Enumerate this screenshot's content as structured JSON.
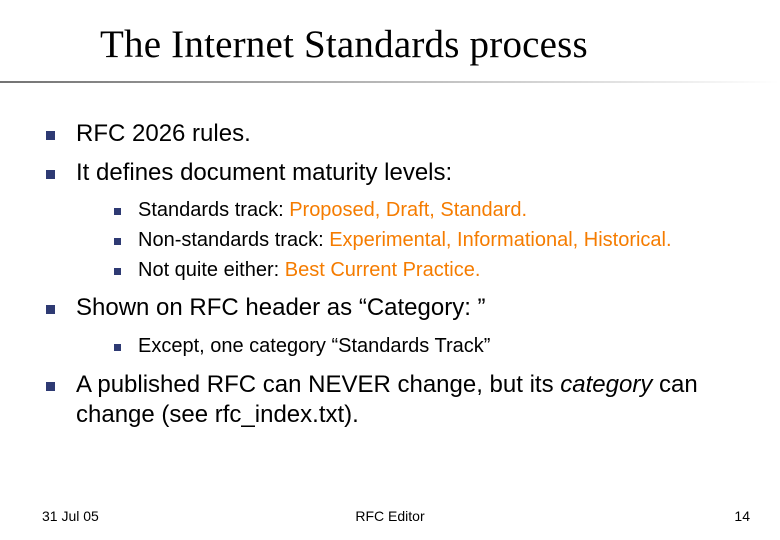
{
  "title": "The Internet Standards process",
  "points": {
    "p0": "RFC 2026 rules.",
    "p1": "It defines document maturity levels:",
    "p1_sub": {
      "s0_a": "Standards track: ",
      "s0_b": "Proposed, Draft, Standard.",
      "s1_a": "Non-standards track: ",
      "s1_b": "Experimental, Informational, Historical.",
      "s2_a": "Not quite either: ",
      "s2_b": "Best Current Practice."
    },
    "p2": "Shown on RFC header as “Category: ”",
    "p2_sub": {
      "s0": "Except, one category “Standards Track”"
    },
    "p3_a": "A published RFC can NEVER change, but its ",
    "p3_b": "category",
    "p3_c": " can change (see rfc_index.txt)."
  },
  "footer": {
    "date": "31 Jul 05",
    "center": "RFC Editor",
    "page": "14"
  }
}
